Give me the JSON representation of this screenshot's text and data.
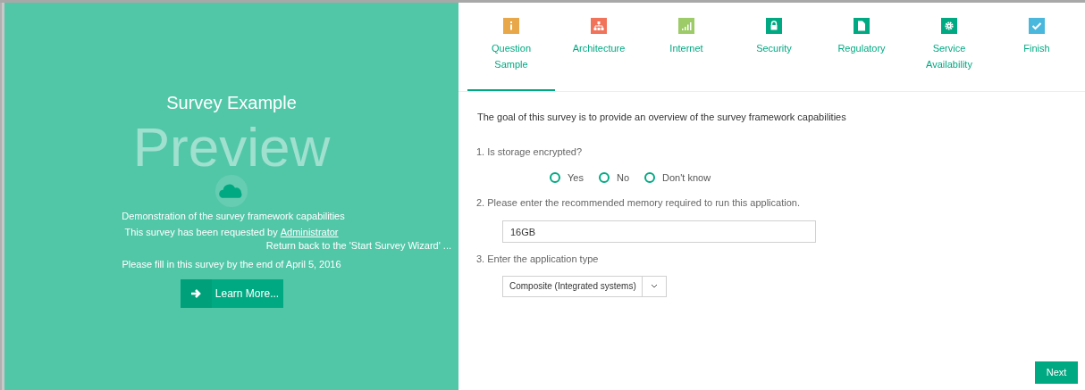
{
  "intro": {
    "title": "Survey Example",
    "overlay": "Preview",
    "description": "Demonstration of the survey framework capabilities",
    "requested_by": "This survey has been requested by",
    "requester": "Administrator",
    "return_link": "Return back to the 'Start Survey Wizard' ...",
    "deadline": "Please fill in this survey by the end of April 5, 2016",
    "button": "Learn More..."
  },
  "steps": [
    {
      "label": "Question Sample",
      "kind": "info",
      "color": "#e8a84a",
      "selected": true
    },
    {
      "label": "Architecture",
      "kind": "hierarchy",
      "color": "#f0735a",
      "selected": false
    },
    {
      "label": "Internet",
      "kind": "signal",
      "color": "#9ccb68",
      "selected": false
    },
    {
      "label": "Security",
      "kind": "lock",
      "color": "#01a982",
      "selected": false
    },
    {
      "label": "Regulatory",
      "kind": "document",
      "color": "#01a982",
      "selected": false
    },
    {
      "label": "Service Availability",
      "kind": "gear",
      "color": "#01a982",
      "selected": false
    },
    {
      "label": "Finish",
      "kind": "check",
      "color": "#4ab8dc",
      "selected": false
    }
  ],
  "goal": "The goal of this survey is to provide an overview of the survey framework capabilities",
  "questions": [
    {
      "kind": "radio",
      "label": "1. Is storage encrypted?",
      "options": [
        {
          "label": "Yes",
          "selected": false
        },
        {
          "label": "No",
          "selected": false
        },
        {
          "label": "Don't know",
          "selected": false
        }
      ]
    },
    {
      "kind": "text",
      "label": "2. Please enter the recommended memory required to run this application.",
      "value": "16GB"
    },
    {
      "kind": "select",
      "label": "3. Enter the application type",
      "value": "Composite (Integrated systems)"
    }
  ],
  "next_button": "Next"
}
